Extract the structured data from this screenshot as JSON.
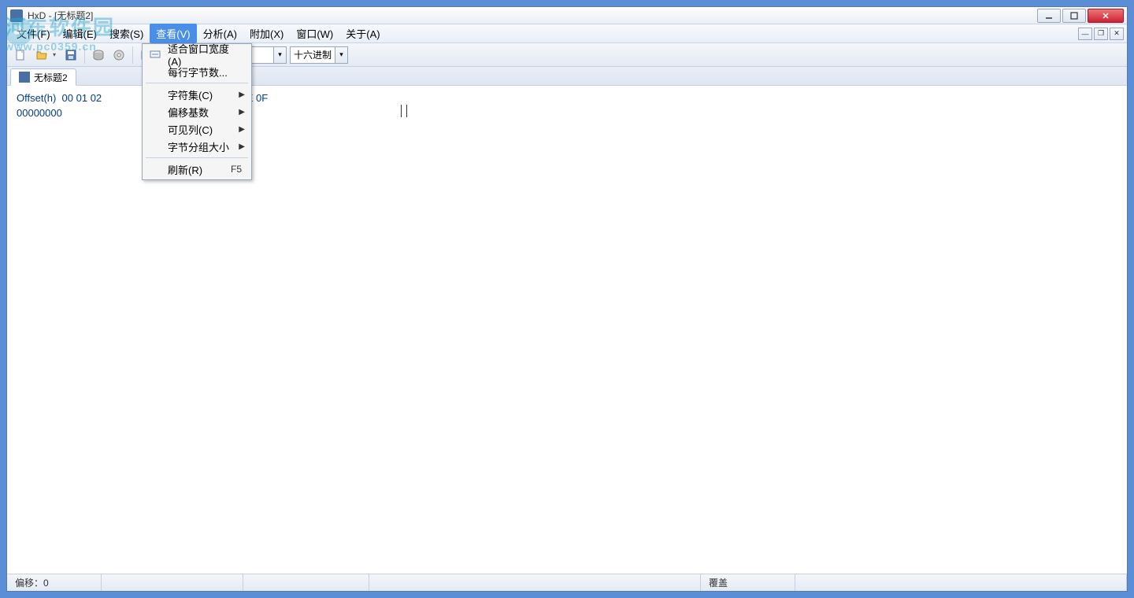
{
  "title": "HxD - [无标题2]",
  "watermark": {
    "line1": "河东软件园",
    "line2": "www.pc0359.cn"
  },
  "menu": {
    "file": "文件(F)",
    "edit": "编辑(E)",
    "search": "搜索(S)",
    "view": "查看(V)",
    "analysis": "分析(A)",
    "extras": "附加(X)",
    "window": "窗口(W)",
    "help": "关于(A)"
  },
  "toolbar": {
    "bytes_width_value": "",
    "radix_value": "十六进制"
  },
  "view_menu": {
    "fit_width": "适合窗口宽度(A)",
    "bytes_per_line": "每行字节数...",
    "charset": "字符集(C)",
    "offset_base": "偏移基数",
    "visible_cols": "可见列(C)",
    "group_size": "字节分组大小",
    "refresh": "刷新(R)",
    "refresh_shortcut": "F5"
  },
  "tab": {
    "title": "无标题2"
  },
  "editor": {
    "offset_header": "Offset(h)  00 01 02                      09 0A 0B 0C 0D 0E 0F",
    "row0": "00000000"
  },
  "status": {
    "offset_label": "偏移：",
    "offset_value": "0",
    "mode": "覆盖"
  }
}
